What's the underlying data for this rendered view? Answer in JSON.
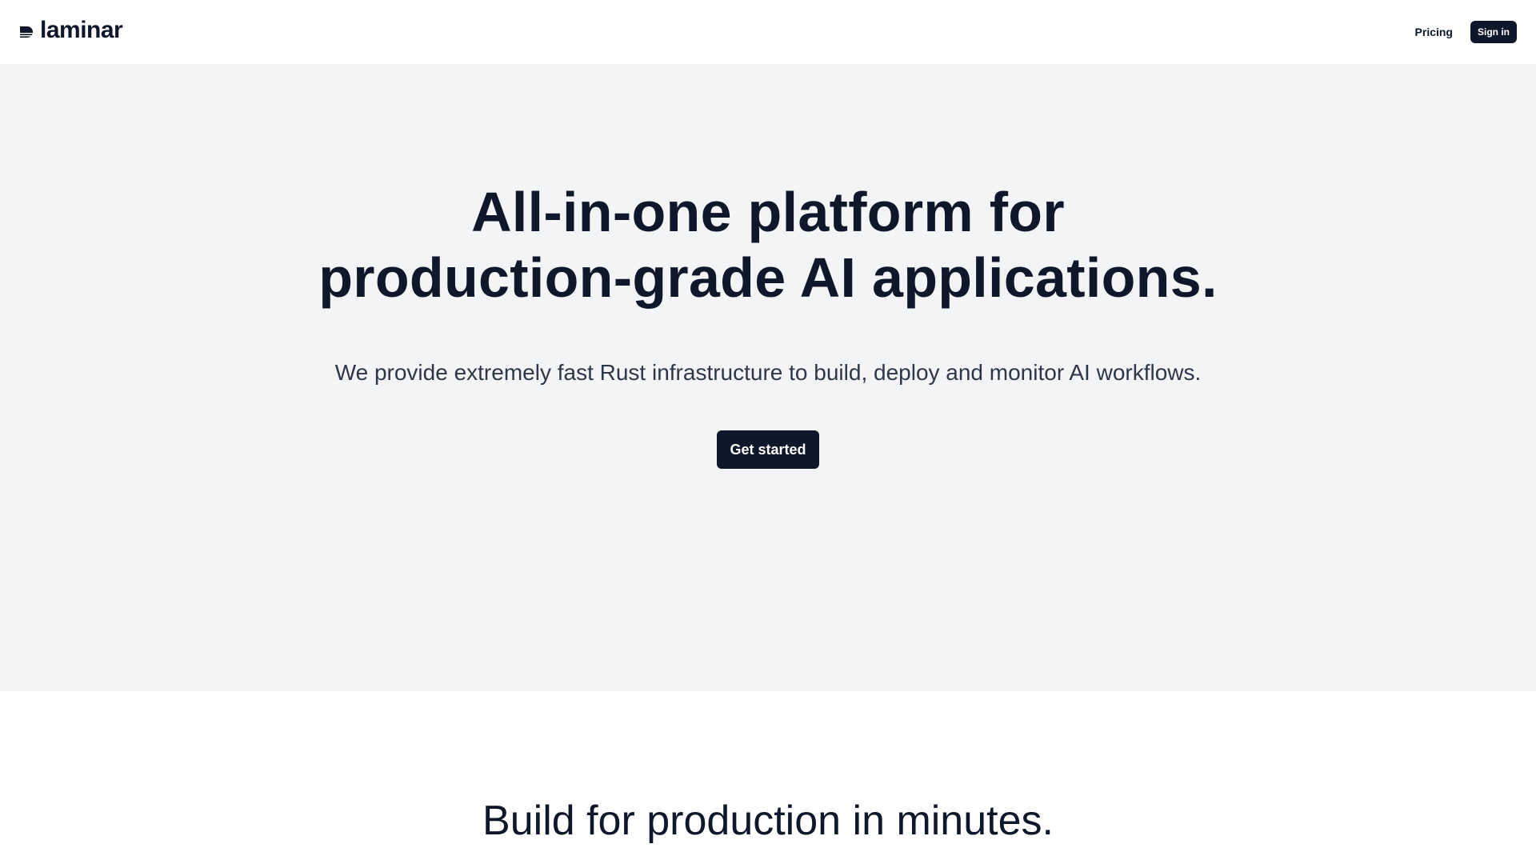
{
  "header": {
    "logo_text": "laminar",
    "logo_icon": "laminar-logo-mark",
    "nav": {
      "pricing_label": "Pricing",
      "signin_label": "Sign in"
    }
  },
  "hero": {
    "title_line1": "All-in-one platform for",
    "title_line2": "production-grade AI applications.",
    "subtitle": "We provide extremely fast Rust infrastructure to build, deploy and monitor AI workflows.",
    "cta_label": "Get started"
  },
  "section": {
    "title": "Build for production in minutes."
  },
  "colors": {
    "primary": "#0f172a",
    "hero_bg": "#f3f4f6",
    "page_bg": "#ffffff",
    "subtitle_text": "#2d3748"
  }
}
